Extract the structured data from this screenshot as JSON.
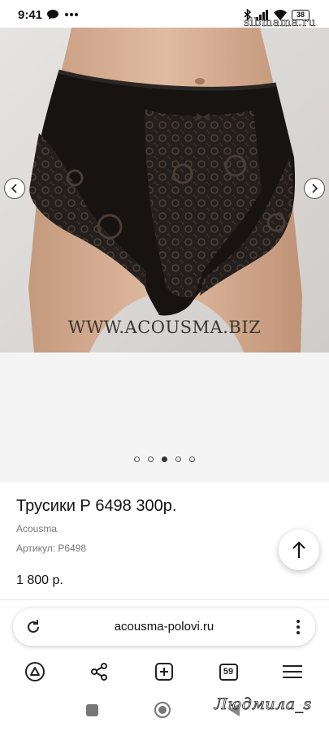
{
  "status_bar": {
    "time": "9:41",
    "battery": "38",
    "watermark": "sibmama.ru",
    "icons": [
      "chat-bubble-icon",
      "more-dots-icon",
      "bluetooth-icon",
      "signal-icon",
      "wifi-icon",
      "battery-icon"
    ]
  },
  "gallery": {
    "caption": "WWW.ACOUSMA.BIZ",
    "slide_count": 5,
    "active_slide": 3,
    "prev_icon": "chevron-left-icon",
    "next_icon": "chevron-right-icon"
  },
  "product": {
    "title": "Трусики Р 6498 300р.",
    "brand": "Acousma",
    "sku": "Артикул: P6498",
    "price": "1 800 р."
  },
  "browser": {
    "url": "acousma-polovi.ru",
    "tab_count": "59",
    "toolbar_icons": [
      "alice-icon",
      "share-icon",
      "new-tab-icon",
      "tabs-icon",
      "menu-icon"
    ]
  },
  "system_nav": {
    "signature": "Людмила_s"
  },
  "colors": {
    "page_bg": "#ffffff",
    "gallery_bg": "#f4f4f4",
    "text_primary": "#111111",
    "text_secondary": "#777777"
  }
}
